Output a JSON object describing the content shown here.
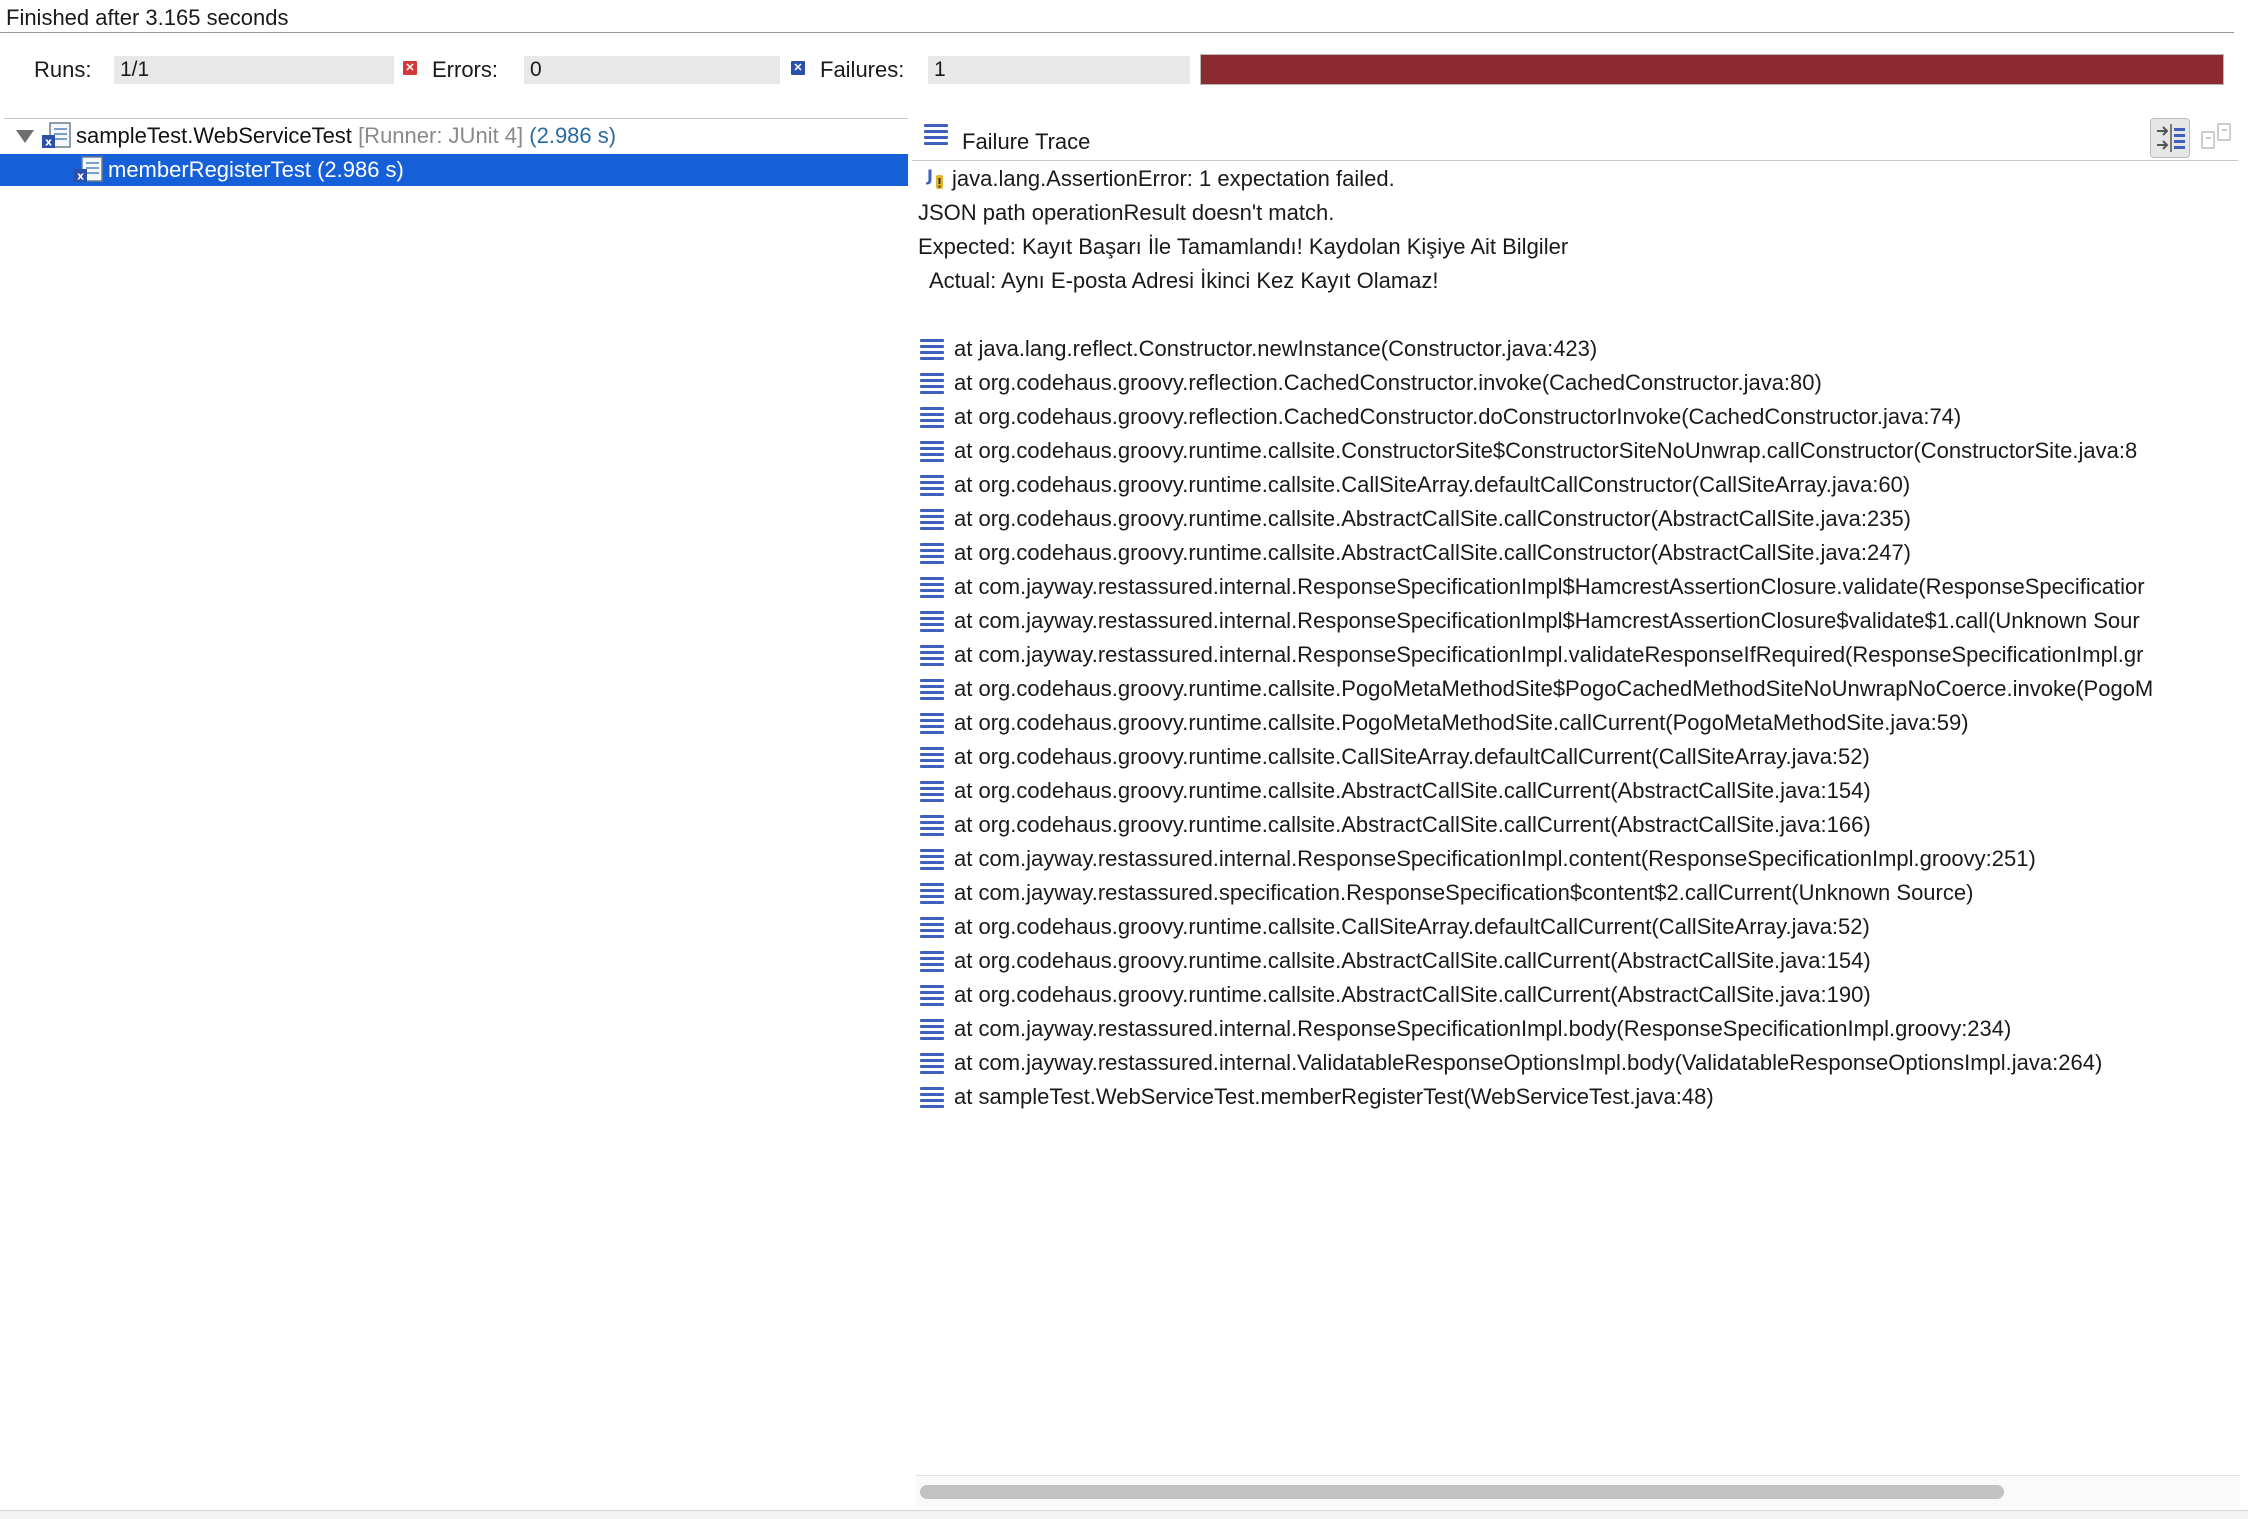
{
  "status": {
    "finished_text": "Finished after 3.165 seconds"
  },
  "counters": {
    "runs_label": "Runs:",
    "runs_value": "1/1",
    "errors_label": "Errors:",
    "errors_value": "0",
    "failures_label": "Failures:",
    "failures_value": "1",
    "progress_fraction": 1.0,
    "progress_color": "#8b2a2f"
  },
  "tree": {
    "suite": {
      "name": "sampleTest.WebServiceTest",
      "runner": "[Runner: JUnit 4]",
      "time": "(2.986 s)",
      "icon": "test-suite-error-icon"
    },
    "cases": [
      {
        "label": "memberRegisterTest (2.986 s)",
        "icon": "test-failed-icon",
        "selected": true
      }
    ]
  },
  "trace": {
    "title": "Failure Trace",
    "message_lines": [
      "java.lang.AssertionError: 1 expectation failed.",
      "JSON path operationResult doesn't match.",
      "Expected: Kayıt Başarı İle Tamamlandı! Kaydolan Kişiye Ait Bilgiler",
      "  Actual: Aynı E-posta Adresi İkinci Kez Kayıt Olamaz!"
    ],
    "frames": [
      "at java.lang.reflect.Constructor.newInstance(Constructor.java:423)",
      "at org.codehaus.groovy.reflection.CachedConstructor.invoke(CachedConstructor.java:80)",
      "at org.codehaus.groovy.reflection.CachedConstructor.doConstructorInvoke(CachedConstructor.java:74)",
      "at org.codehaus.groovy.runtime.callsite.ConstructorSite$ConstructorSiteNoUnwrap.callConstructor(ConstructorSite.java:8",
      "at org.codehaus.groovy.runtime.callsite.CallSiteArray.defaultCallConstructor(CallSiteArray.java:60)",
      "at org.codehaus.groovy.runtime.callsite.AbstractCallSite.callConstructor(AbstractCallSite.java:235)",
      "at org.codehaus.groovy.runtime.callsite.AbstractCallSite.callConstructor(AbstractCallSite.java:247)",
      "at com.jayway.restassured.internal.ResponseSpecificationImpl$HamcrestAssertionClosure.validate(ResponseSpecificatior",
      "at com.jayway.restassured.internal.ResponseSpecificationImpl$HamcrestAssertionClosure$validate$1.call(Unknown Sour",
      "at com.jayway.restassured.internal.ResponseSpecificationImpl.validateResponseIfRequired(ResponseSpecificationImpl.gr",
      "at org.codehaus.groovy.runtime.callsite.PogoMetaMethodSite$PogoCachedMethodSiteNoUnwrapNoCoerce.invoke(PogoM",
      "at org.codehaus.groovy.runtime.callsite.PogoMetaMethodSite.callCurrent(PogoMetaMethodSite.java:59)",
      "at org.codehaus.groovy.runtime.callsite.CallSiteArray.defaultCallCurrent(CallSiteArray.java:52)",
      "at org.codehaus.groovy.runtime.callsite.AbstractCallSite.callCurrent(AbstractCallSite.java:154)",
      "at org.codehaus.groovy.runtime.callsite.AbstractCallSite.callCurrent(AbstractCallSite.java:166)",
      "at com.jayway.restassured.internal.ResponseSpecificationImpl.content(ResponseSpecificationImpl.groovy:251)",
      "at com.jayway.restassured.specification.ResponseSpecification$content$2.callCurrent(Unknown Source)",
      "at org.codehaus.groovy.runtime.callsite.CallSiteArray.defaultCallCurrent(CallSiteArray.java:52)",
      "at org.codehaus.groovy.runtime.callsite.AbstractCallSite.callCurrent(AbstractCallSite.java:154)",
      "at org.codehaus.groovy.runtime.callsite.AbstractCallSite.callCurrent(AbstractCallSite.java:190)",
      "at com.jayway.restassured.internal.ResponseSpecificationImpl.body(ResponseSpecificationImpl.groovy:234)",
      "at com.jayway.restassured.internal.ValidatableResponseOptionsImpl.body(ValidatableResponseOptionsImpl.java:264)",
      "at sampleTest.WebServiceTest.memberRegisterTest(WebServiceTest.java:48)"
    ],
    "toolbar": [
      {
        "icon": "filter-stack-trace-icon",
        "active": true
      },
      {
        "icon": "compare-results-icon",
        "active": false
      }
    ]
  },
  "colors": {
    "selection": "#1560d8",
    "failure_bar": "#8b2a2f",
    "stack_icon": "#3f5fbd",
    "error_icon": "#d23a3a",
    "failure_icon": "#2c4fa8"
  }
}
